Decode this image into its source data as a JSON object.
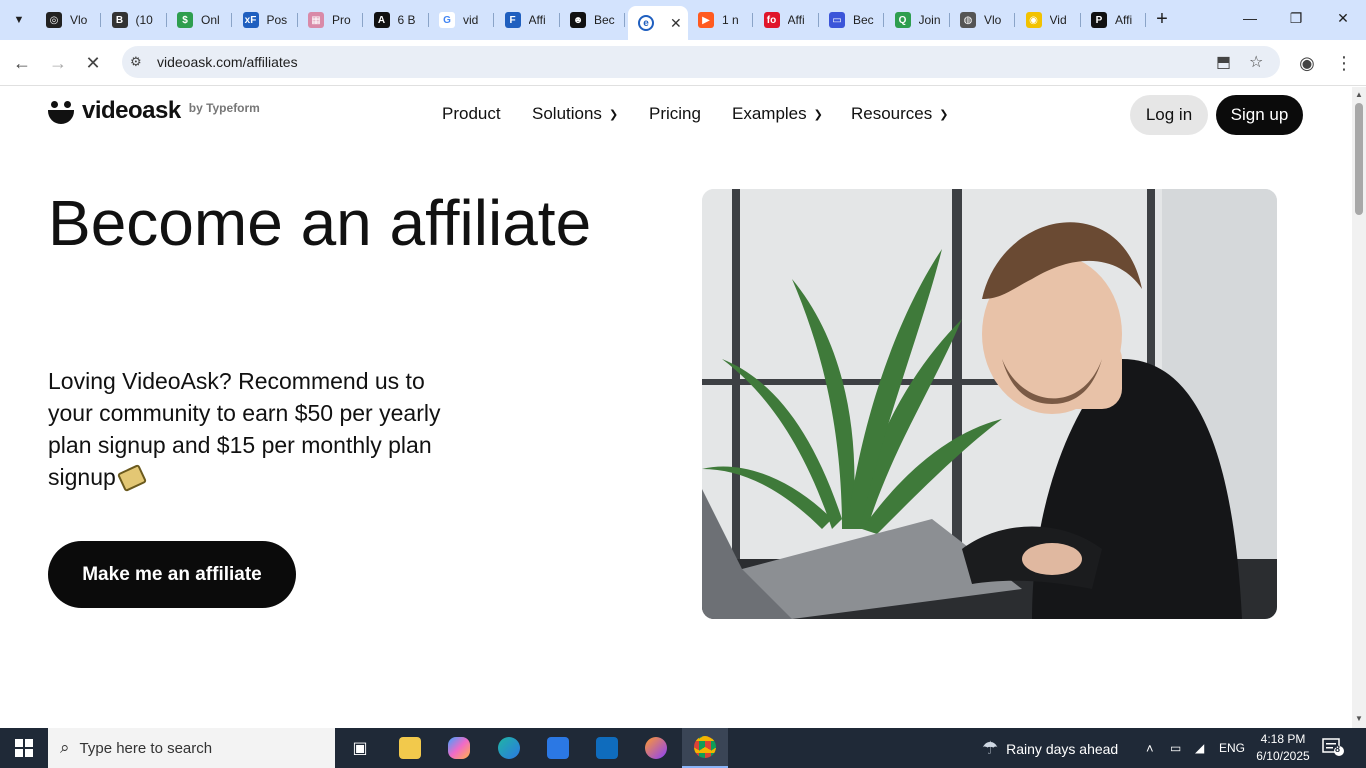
{
  "browser": {
    "tabs": [
      {
        "title": "Vlo",
        "color": "#222222",
        "glyph": "◎"
      },
      {
        "title": "(10",
        "color": "#333333",
        "glyph": "B"
      },
      {
        "title": "Onl",
        "color": "#2e9e4f",
        "glyph": "$"
      },
      {
        "title": "Pos",
        "color": "#1f5fbf",
        "glyph": "xF"
      },
      {
        "title": "Pro",
        "color": "#d98aa8",
        "glyph": "▦"
      },
      {
        "title": "6 B",
        "color": "#111111",
        "glyph": "A"
      },
      {
        "title": "vid",
        "color": "#ffffff",
        "glyph": "G"
      },
      {
        "title": "Affi",
        "color": "#1f5fbf",
        "glyph": "F"
      },
      {
        "title": "Bec",
        "color": "#111111",
        "glyph": "☻"
      },
      {
        "title": "1 n",
        "color": "#ff5a1f",
        "glyph": "▶"
      },
      {
        "title": "Affi",
        "color": "#e0162b",
        "glyph": "fo"
      },
      {
        "title": "Bec",
        "color": "#3b55d9",
        "glyph": "▭"
      },
      {
        "title": "Join",
        "color": "#2e9e4f",
        "glyph": "Q"
      },
      {
        "title": "Vlo",
        "color": "#555555",
        "glyph": "◍"
      },
      {
        "title": "Vid",
        "color": "#f2c200",
        "glyph": "◉"
      },
      {
        "title": "Affi",
        "color": "#111111",
        "glyph": "P"
      }
    ],
    "active_tab_index": 9,
    "active_tab_close": "✕",
    "new_tab": "+",
    "url": "videoask.com/affiliates"
  },
  "site": {
    "logo_text": "videoask",
    "logo_by": "by Typeform",
    "nav": [
      {
        "label": "Product",
        "dropdown": false
      },
      {
        "label": "Solutions",
        "dropdown": true
      },
      {
        "label": "Pricing",
        "dropdown": false
      },
      {
        "label": "Examples",
        "dropdown": true
      },
      {
        "label": "Resources",
        "dropdown": true
      }
    ],
    "login": "Log in",
    "signup": "Sign up",
    "hero_title": "Become an affiliate",
    "hero_sub": "Loving VideoAsk? Recommend us to your community to earn $50 per yearly plan signup and $15 per monthly plan signup",
    "cta": "Make me an affiliate"
  },
  "taskbar": {
    "search_placeholder": "Type here to search",
    "weather": "Rainy days ahead",
    "lang": "ENG",
    "time": "4:18 PM",
    "date": "6/10/2025",
    "notifications": "8"
  },
  "colors": {
    "tabstrip": "#d3e3fd",
    "brand_black": "#0b0b0b",
    "taskbar": "#1f2937"
  }
}
